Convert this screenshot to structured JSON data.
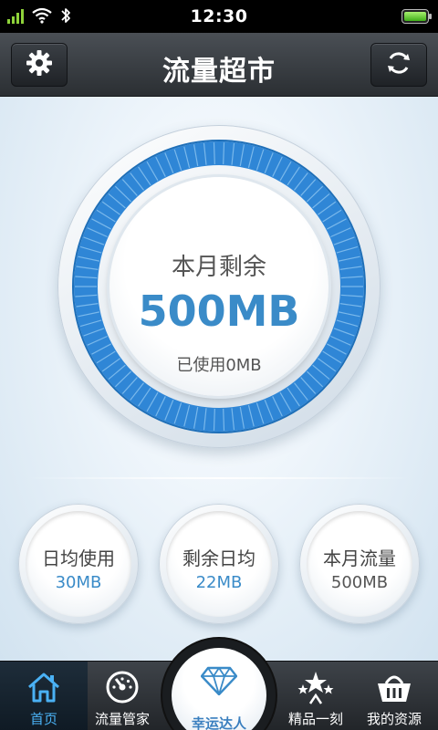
{
  "status_bar": {
    "time": "12:30"
  },
  "header": {
    "title": "流量超市",
    "settings_icon": "gear-icon",
    "refresh_icon": "refresh-icon"
  },
  "gauge": {
    "label": "本月剩余",
    "value": "500MB",
    "used": "已使用0MB"
  },
  "stats": [
    {
      "label": "日均使用",
      "value": "30MB"
    },
    {
      "label": "剩余日均",
      "value": "22MB"
    },
    {
      "label": "本月流量",
      "value": "500MB"
    }
  ],
  "nav": {
    "home": {
      "label": "首页",
      "icon": "home-icon"
    },
    "manager": {
      "label": "流量管家",
      "icon": "gauge-icon"
    },
    "lucky": {
      "label": "幸运达人",
      "icon": "diamond-icon"
    },
    "boutique": {
      "label": "精品一刻",
      "icon": "stars-icon"
    },
    "resources": {
      "label": "我的资源",
      "icon": "basket-icon"
    }
  },
  "colors": {
    "accent": "#3a8bc8",
    "ring": "#2f86d6",
    "active_nav": "#4ab1f4"
  }
}
